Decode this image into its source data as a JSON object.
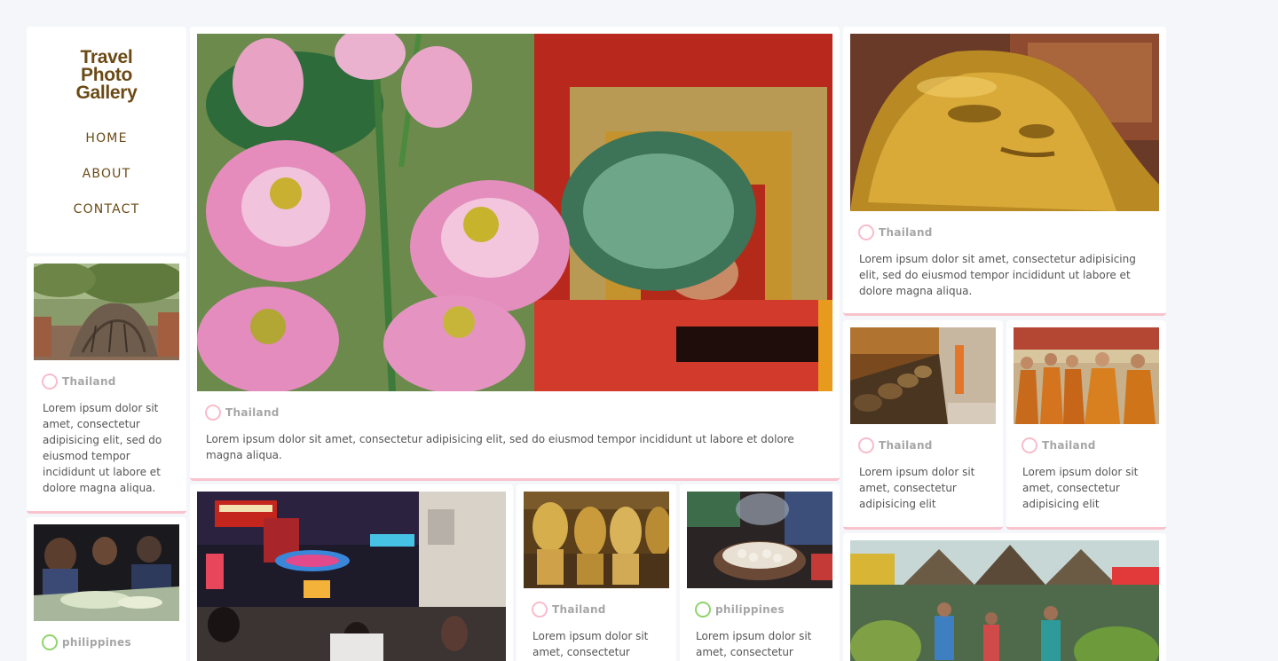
{
  "site": {
    "title": "Travel\nPhoto\nGallery",
    "nav": [
      "HOME",
      "ABOUT",
      "CONTACT"
    ]
  },
  "colors": {
    "brand": "#6b4a16",
    "accent_border": "#f8c3cd",
    "thailand_ring": "#f8bccb",
    "philippines_ring": "#8fd46c",
    "background": "#f4f6fa"
  },
  "cards": {
    "tree_buddha": {
      "location": "Thailand",
      "text": "Lorem ipsum dolor sit amet, consectetur adipisicing elit, sed do eiusmod tempor incididunt ut labore et dolore magna aliqua."
    },
    "lotus_feature": {
      "location": "Thailand",
      "text": "Lorem ipsum dolor sit amet, consectetur adipisicing elit, sed do eiusmod tempor incididunt ut labore et dolore magna aliqua."
    },
    "reclining_buddha": {
      "location": "Thailand",
      "text": "Lorem ipsum dolor sit amet, consectetur adipisicing elit, sed do eiusmod tempor incididunt ut labore et dolore magna aliqua."
    },
    "alms_bowls": {
      "location": "Thailand",
      "text": "Lorem ipsum dolor sit amet, consectetur adipisicing elit"
    },
    "monks": {
      "location": "Thailand",
      "text": "Lorem ipsum dolor sit amet, consectetur adipisicing elit"
    },
    "feast": {
      "location": "philippines"
    },
    "night_street": {},
    "golden_statues": {
      "location": "Thailand",
      "text": "Lorem ipsum dolor sit amet, consectetur"
    },
    "street_food": {
      "location": "philippines",
      "text": "Lorem ipsum dolor sit amet, consectetur"
    },
    "market": {}
  }
}
